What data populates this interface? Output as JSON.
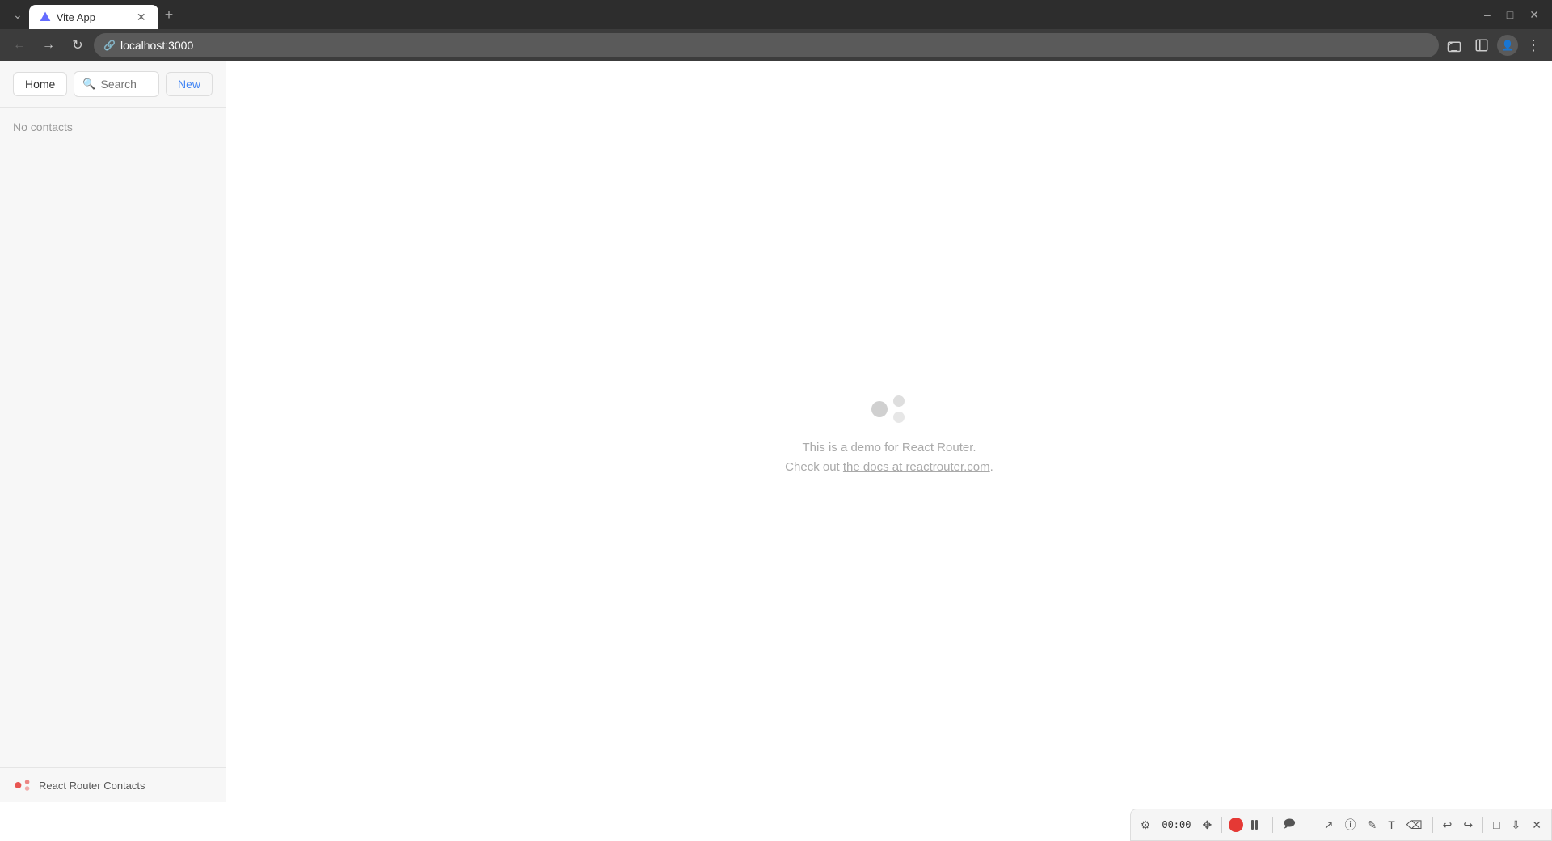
{
  "browser": {
    "tab_title": "Vite App",
    "url": "localhost:3000",
    "new_tab_tooltip": "New tab"
  },
  "sidebar": {
    "home_label": "Home",
    "search_placeholder": "Search",
    "new_label": "New",
    "no_contacts_label": "No contacts",
    "footer_app_name": "React Router Contacts"
  },
  "main": {
    "demo_line1": "This is a demo for React Router.",
    "demo_line2_prefix": "Check out ",
    "demo_link_text": "the docs at reactrouter.com",
    "demo_line2_suffix": "."
  },
  "bottom_toolbar": {
    "time": "00:00"
  }
}
